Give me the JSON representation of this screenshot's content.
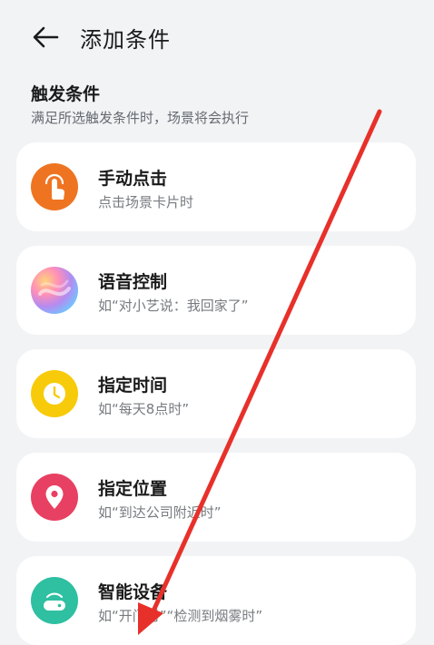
{
  "header": {
    "title": "添加条件",
    "back_icon": "arrow-left-icon"
  },
  "section": {
    "title": "触发条件",
    "subtitle": "满足所选触发条件时，场景将会执行"
  },
  "conditions": [
    {
      "title": "手动点击",
      "desc": "点击场景卡片时",
      "icon": "hand-tap-icon",
      "color": "#ef7421"
    },
    {
      "title": "语音控制",
      "desc": "如“对小艺说：我回家了”",
      "icon": "voice-assistant-orb-icon",
      "color": "#b58bf0"
    },
    {
      "title": "指定时间",
      "desc": "如“每天8点时”",
      "icon": "clock-icon",
      "color": "#f7cb0a"
    },
    {
      "title": "指定位置",
      "desc": "如“到达公司附近时”",
      "icon": "location-pin-icon",
      "color": "#e84062"
    },
    {
      "title": "智能设备",
      "desc": "如“开门时”“检测到烟雾时”",
      "icon": "router-device-icon",
      "color": "#2fbfa1"
    }
  ],
  "annotation": {
    "arrow_color": "#e8302a"
  }
}
